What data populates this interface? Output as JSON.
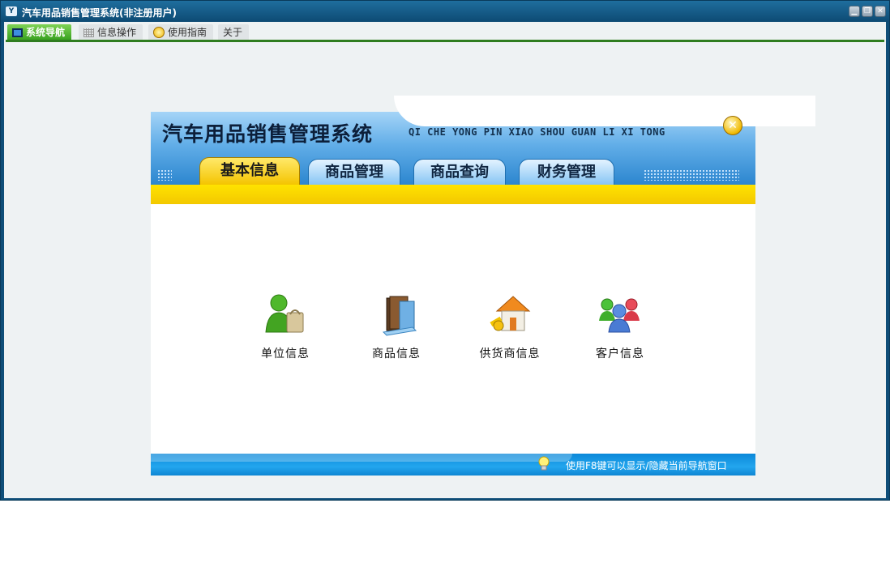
{
  "window": {
    "title": "汽车用品销售管理系统(非注册用户)",
    "app_icon_glyph": "Y"
  },
  "menu": {
    "items": [
      {
        "label": "系统导航",
        "icon": "monitor-icon"
      },
      {
        "label": "信息操作",
        "icon": "grid-icon"
      },
      {
        "label": "使用指南",
        "icon": "help-icon"
      },
      {
        "label": "关于",
        "icon": ""
      }
    ]
  },
  "header": {
    "title": "汽车用品销售管理系统",
    "pinyin": "QI CHE YONG PIN XIAO SHOU GUAN LI XI TONG",
    "close_glyph": "✕"
  },
  "tabs": [
    {
      "label": "基本信息",
      "active": true
    },
    {
      "label": "商品管理",
      "active": false
    },
    {
      "label": "商品查询",
      "active": false
    },
    {
      "label": "财务管理",
      "active": false
    }
  ],
  "icons": [
    {
      "label": "单位信息",
      "icon": "unit-person-bag-icon"
    },
    {
      "label": "商品信息",
      "icon": "goods-books-icon"
    },
    {
      "label": "供货商信息",
      "icon": "supplier-house-icon"
    },
    {
      "label": "客户信息",
      "icon": "customers-group-icon"
    }
  ],
  "footer": {
    "hint": "使用F8键可以显示/隐藏当前导航窗口"
  },
  "colors": {
    "frame": "#0f4e78",
    "menu_active": "#36a01e",
    "tab_active": "#f4c400",
    "header_blue": "#2c86cf",
    "footer_blue": "#23a6ee"
  }
}
